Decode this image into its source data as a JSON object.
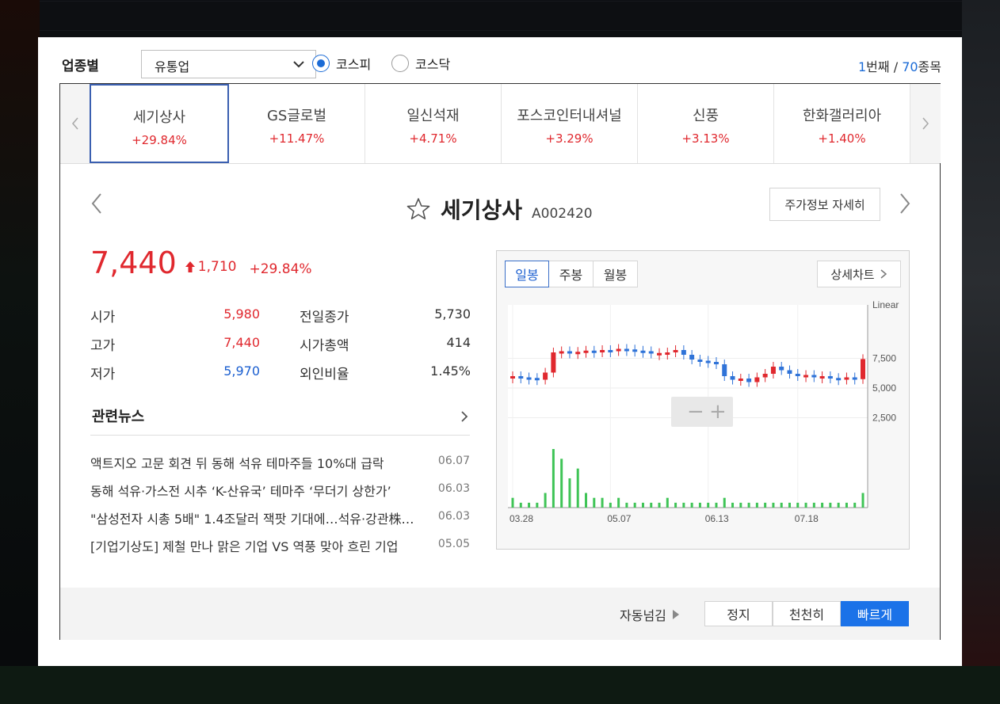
{
  "header": {
    "category_label": "업종별",
    "category_select": "유통업",
    "market_options": [
      {
        "label": "코스피",
        "selected": true
      },
      {
        "label": "코스닥",
        "selected": false
      }
    ],
    "counter": {
      "current": "1",
      "current_suffix": "번째",
      "sep": " / ",
      "total": "70",
      "total_suffix": "종목"
    }
  },
  "strip": {
    "tabs": [
      {
        "name": "세기상사",
        "change": "+29.84%",
        "active": true
      },
      {
        "name": "GS글로벌",
        "change": "+11.47%",
        "active": false
      },
      {
        "name": "일신석재",
        "change": "+4.71%",
        "active": false
      },
      {
        "name": "포스코인터내셔널",
        "change": "+3.29%",
        "active": false
      },
      {
        "name": "신풍",
        "change": "+3.13%",
        "active": false
      },
      {
        "name": "한화갤러리아",
        "change": "+1.40%",
        "active": false
      }
    ]
  },
  "stock": {
    "name": "세기상사",
    "code": "A002420",
    "detail_button": "주가정보 자세히",
    "price": "7,440",
    "change": "1,710",
    "change_pct": "+29.84%",
    "stats_left": [
      {
        "label": "시가",
        "value": "5,980",
        "color": "red"
      },
      {
        "label": "고가",
        "value": "7,440",
        "color": "red"
      },
      {
        "label": "저가",
        "value": "5,970",
        "color": "blue"
      }
    ],
    "stats_right": [
      {
        "label": "전일종가",
        "value": "5,730"
      },
      {
        "label": "시가총액",
        "value": "414"
      },
      {
        "label": "외인비율",
        "value": "1.45%"
      }
    ]
  },
  "news": {
    "title": "관련뉴스",
    "items": [
      {
        "title": "액트지오 고문 회견 뒤 동해 석유 테마주들 10%대 급락",
        "date": "06.07"
      },
      {
        "title": "동해 석유·가스전 시추 ‘K-산유국’ 테마주 ‘무더기 상한가’",
        "date": "06.03"
      },
      {
        "title": "\"삼성전자 시총 5배\" 1.4조달러 잭팟 기대에…석유·강관株…",
        "date": "06.03"
      },
      {
        "title": "[기업기상도] 제철 만나 맑은 기업 VS 역풍 맞아 흐린 기업",
        "date": "05.05"
      }
    ]
  },
  "chart": {
    "tabs": [
      "일봉",
      "주봉",
      "월봉"
    ],
    "active_tab": "일봉",
    "detail_label": "상세차트",
    "scale_label": "Linear",
    "zoom_out": "−",
    "zoom_in": "+"
  },
  "chart_data": {
    "type": "line",
    "x_ticks": [
      "03.28",
      "05.07",
      "06.13",
      "07.18"
    ],
    "y_ticks": [
      2500,
      5000,
      7500
    ],
    "ylim": [
      0,
      12000
    ],
    "series": [
      {
        "values": [
          6000,
          5900,
          5850,
          5700,
          6300,
          8000,
          8100,
          7950,
          8050,
          8150,
          8000,
          8200,
          8100,
          8300,
          8250,
          8150,
          8100,
          7900,
          7950,
          8000,
          8200,
          7800,
          7400,
          7300,
          7200,
          7000,
          6000,
          5700,
          5800,
          5500,
          5900,
          6200,
          6800,
          6500,
          6200,
          6000,
          6100,
          5950,
          6000,
          5850,
          5800,
          5900,
          5750,
          7440
        ]
      }
    ],
    "volume": [
      2,
      1,
      1,
      1,
      3,
      12,
      10,
      6,
      8,
      3,
      2,
      2,
      1,
      2,
      1,
      1,
      1,
      1,
      1,
      2,
      1,
      1,
      1,
      1,
      1,
      1,
      2,
      1,
      1,
      1,
      1,
      1,
      1,
      1,
      1,
      1,
      1,
      1,
      1,
      1,
      1,
      1,
      1,
      3
    ]
  },
  "footer": {
    "auto_label": "자동넘김",
    "buttons": [
      {
        "label": "정지",
        "active": false
      },
      {
        "label": "천천히",
        "active": false
      },
      {
        "label": "빠르게",
        "active": true
      }
    ]
  }
}
